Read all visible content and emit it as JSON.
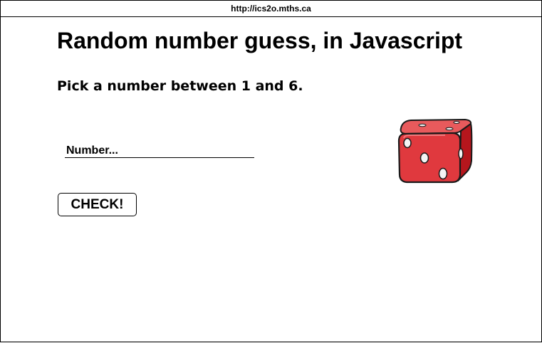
{
  "browser": {
    "url": "http://ics2o.mths.ca"
  },
  "page": {
    "title": "Random number guess, in Javascript",
    "instructions": "Pick a number between 1 and 6."
  },
  "form": {
    "number_placeholder": "Number...",
    "number_value": "",
    "check_label": "CHECK!"
  },
  "image": {
    "icon": "red-dice-icon",
    "colors": {
      "face_front": "#e0393e",
      "face_top": "#e85a5c",
      "face_side": "#b5161d",
      "pip": "#f4f4f4",
      "outline": "#1a1a1a"
    }
  }
}
